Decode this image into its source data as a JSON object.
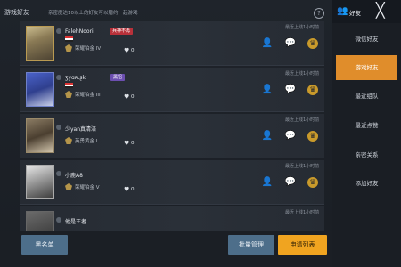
{
  "header": {
    "title": "游戏好友",
    "tip": "亲密度达10以上的好友可以赠约一起游戏",
    "help_symbol": "?"
  },
  "right_header": {
    "title": "好友",
    "close_symbol": "╳"
  },
  "nav": {
    "items": [
      {
        "label": "微信好友",
        "active": false
      },
      {
        "label": "游戏好友",
        "active": true
      },
      {
        "label": "最近组队",
        "active": false
      },
      {
        "label": "最近点赞",
        "active": false
      },
      {
        "label": "亲密关系",
        "active": false
      },
      {
        "label": "添加好友",
        "active": false
      }
    ]
  },
  "friends": [
    {
      "name": "FalehNoori.",
      "tag": "兵神不再",
      "tag_color": "red",
      "rank": "荣耀铂金 IV",
      "likes": "0",
      "last_online": "最近上线1小时前"
    },
    {
      "name": "ӡyɑʀ.ʂk",
      "tag": "黑铝",
      "tag_color": "purple",
      "rank": "荣耀铂金 III",
      "likes": "0",
      "last_online": "最近上线1小时前"
    },
    {
      "name": "少yan真清涪",
      "tag": "",
      "tag_color": "",
      "rank": "英勇黄金 I",
      "likes": "0",
      "last_online": "最近上线1小时前"
    },
    {
      "name": "小鹿A8",
      "tag": "",
      "tag_color": "",
      "rank": "荣耀铂金 V",
      "likes": "0",
      "last_online": "最近上线1小时前"
    },
    {
      "name": "他是王者",
      "tag": "",
      "tag_color": "",
      "rank": "",
      "likes": "",
      "last_online": "最近上线1小时前"
    }
  ],
  "icons": {
    "heart": "♥",
    "add_person": "👤",
    "chat": "💬",
    "gift": "♛",
    "friends": "👥"
  },
  "bottom": {
    "blacklist_label": "黑名单",
    "batch_label": "批量管理",
    "requests_label": "申请列表"
  },
  "colors": {
    "accent_orange": "#e08d2b",
    "button_blue": "#4d6e8a",
    "button_yellow": "#f0a420"
  }
}
